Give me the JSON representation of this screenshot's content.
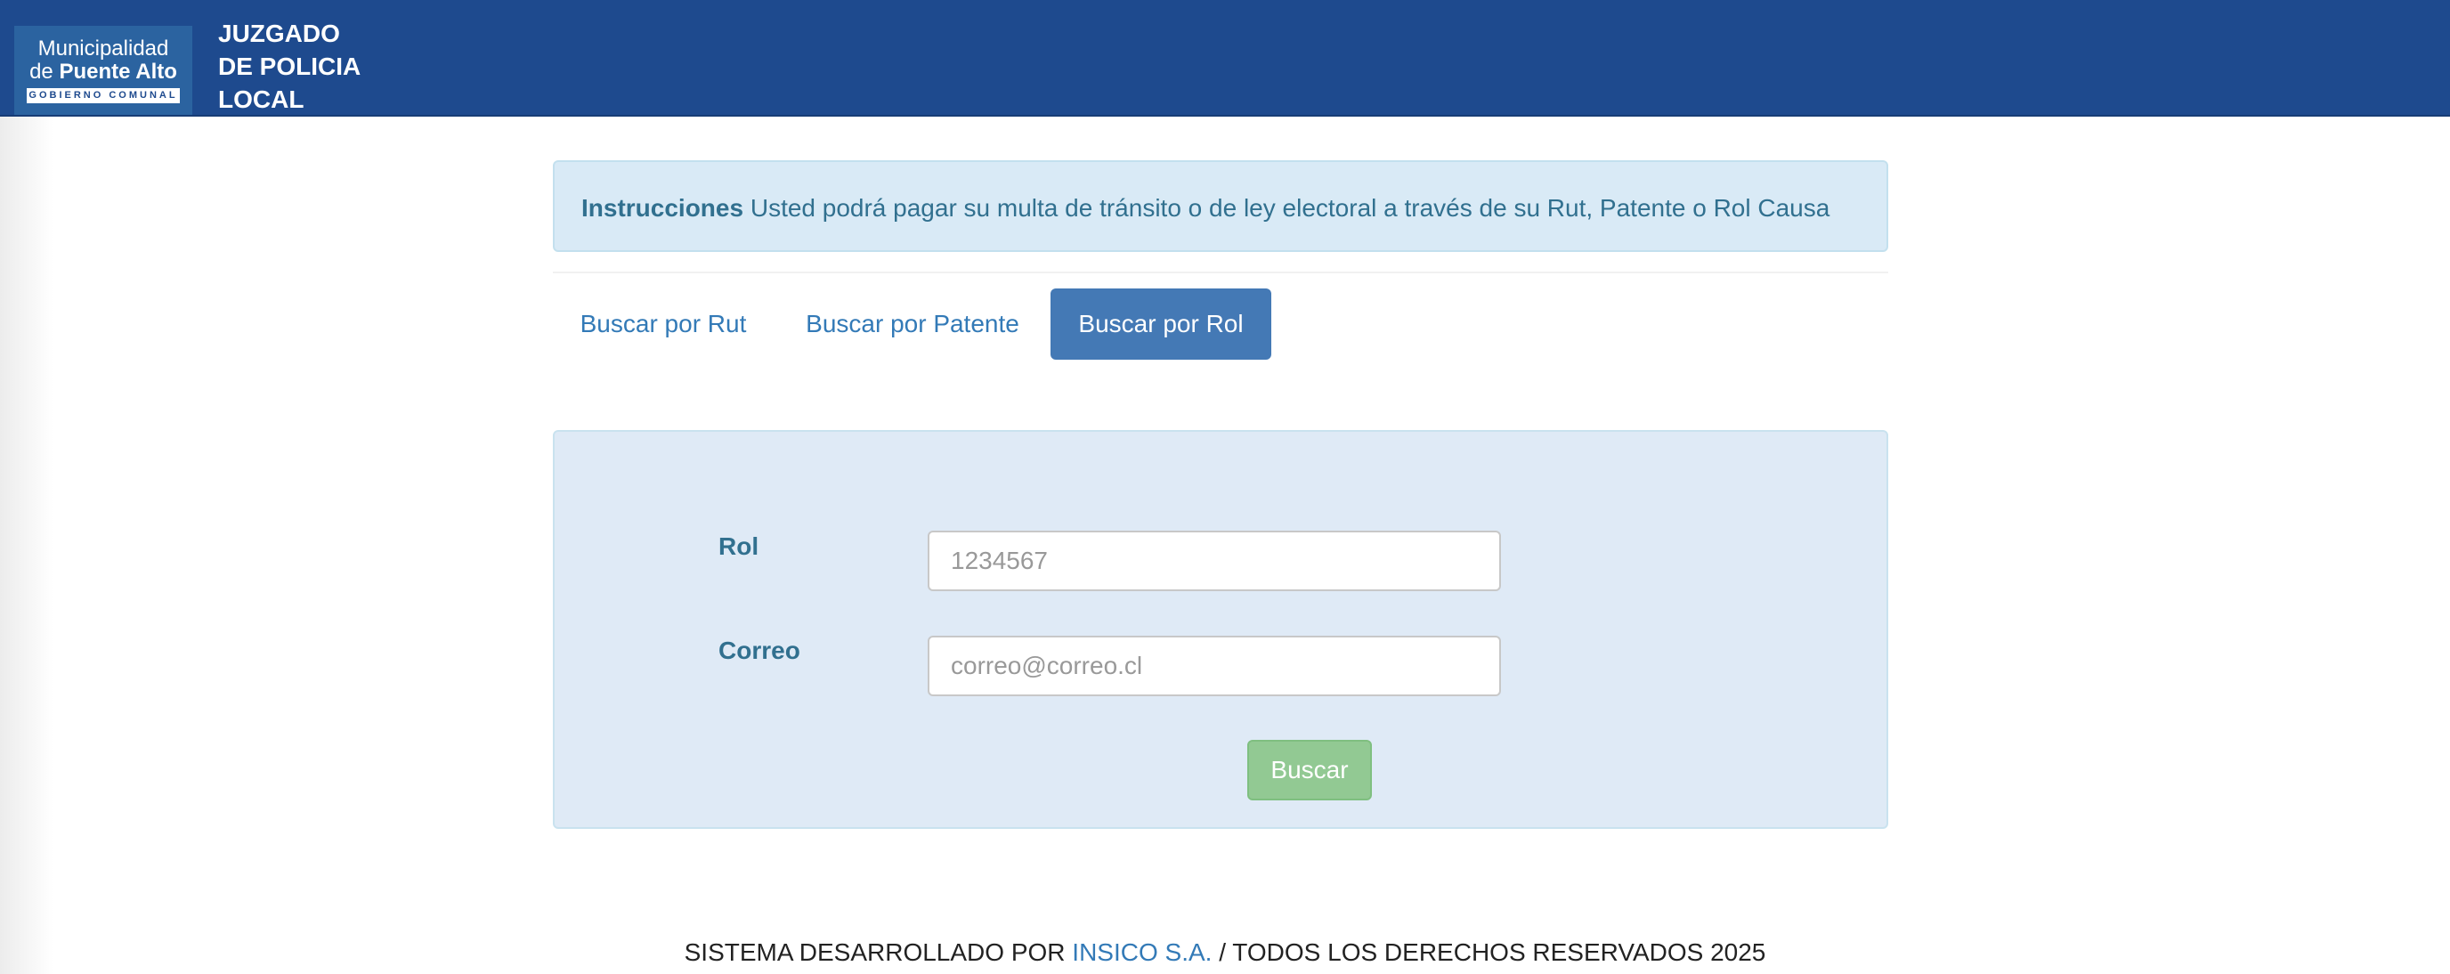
{
  "header": {
    "logo_line1": "Municipalidad",
    "logo_line2_prefix": "de",
    "logo_line2_bold": "Puente Alto",
    "logo_strip": "GOBIERNO COMUNAL",
    "brand_line1": "JUZGADO",
    "brand_line2": "DE POLICIA",
    "brand_line3": "LOCAL"
  },
  "instructions": {
    "title": "Instrucciones",
    "text": "Usted podrá pagar su multa de tránsito o de ley electoral a través de su Rut, Patente o Rol Causa"
  },
  "tabs": [
    {
      "label": "Buscar por Rut",
      "active": false
    },
    {
      "label": "Buscar por Patente",
      "active": false
    },
    {
      "label": "Buscar por Rol",
      "active": true
    }
  ],
  "form": {
    "rol_label": "Rol",
    "rol_placeholder": "1234567",
    "correo_label": "Correo",
    "correo_placeholder": "correo@correo.cl",
    "submit_label": "Buscar"
  },
  "footer": {
    "prefix": "SISTEMA DESARROLLADO POR",
    "company": "INSICO S.A.",
    "suffix": "/ TODOS LOS DERECHOS RESERVADOS 2025"
  },
  "colors": {
    "navbar": "#1e4a8e",
    "active_tab": "#4479b5",
    "link": "#337ab7",
    "button_disabled": "#92c993"
  }
}
